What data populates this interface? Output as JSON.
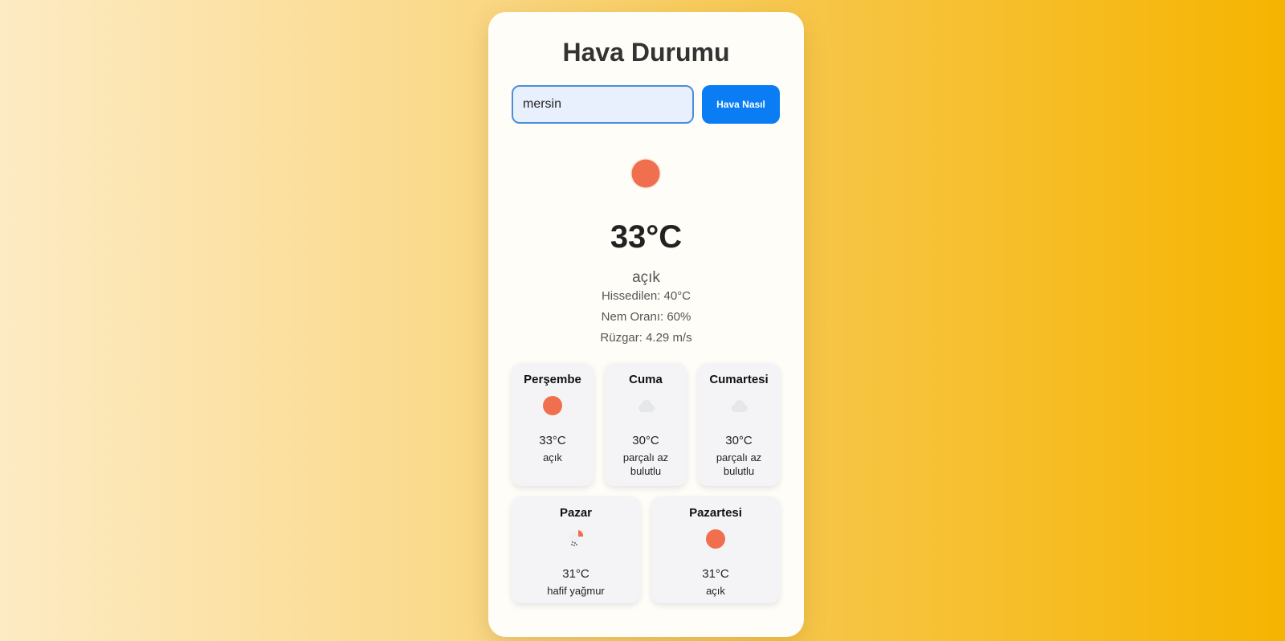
{
  "title": "Hava Durumu",
  "search": {
    "value": "mersin",
    "button_label": "Hava Nasıl"
  },
  "current": {
    "icon": "sun-icon",
    "temperature": "33°C",
    "description": "açık",
    "feels_like": "Hissedilen: 40°C",
    "humidity": "Nem Oranı: 60%",
    "wind": "Rüzgar: 4.29 m/s"
  },
  "forecast": [
    {
      "day": "Perşembe",
      "icon": "sun-icon",
      "temp": "33°C",
      "desc": "açık"
    },
    {
      "day": "Cuma",
      "icon": "cloud-icon",
      "temp": "30°C",
      "desc": "parçalı az bulutlu"
    },
    {
      "day": "Cumartesi",
      "icon": "cloud-icon",
      "temp": "30°C",
      "desc": "parçalı az bulutlu"
    },
    {
      "day": "Pazar",
      "icon": "rain-icon",
      "temp": "31°C",
      "desc": "hafif yağmur"
    },
    {
      "day": "Pazartesi",
      "icon": "sun-icon",
      "temp": "31°C",
      "desc": "açık"
    }
  ],
  "colors": {
    "sun": "#ef6f4f",
    "button": "#0a7df5",
    "input_border": "#4a90d9"
  }
}
